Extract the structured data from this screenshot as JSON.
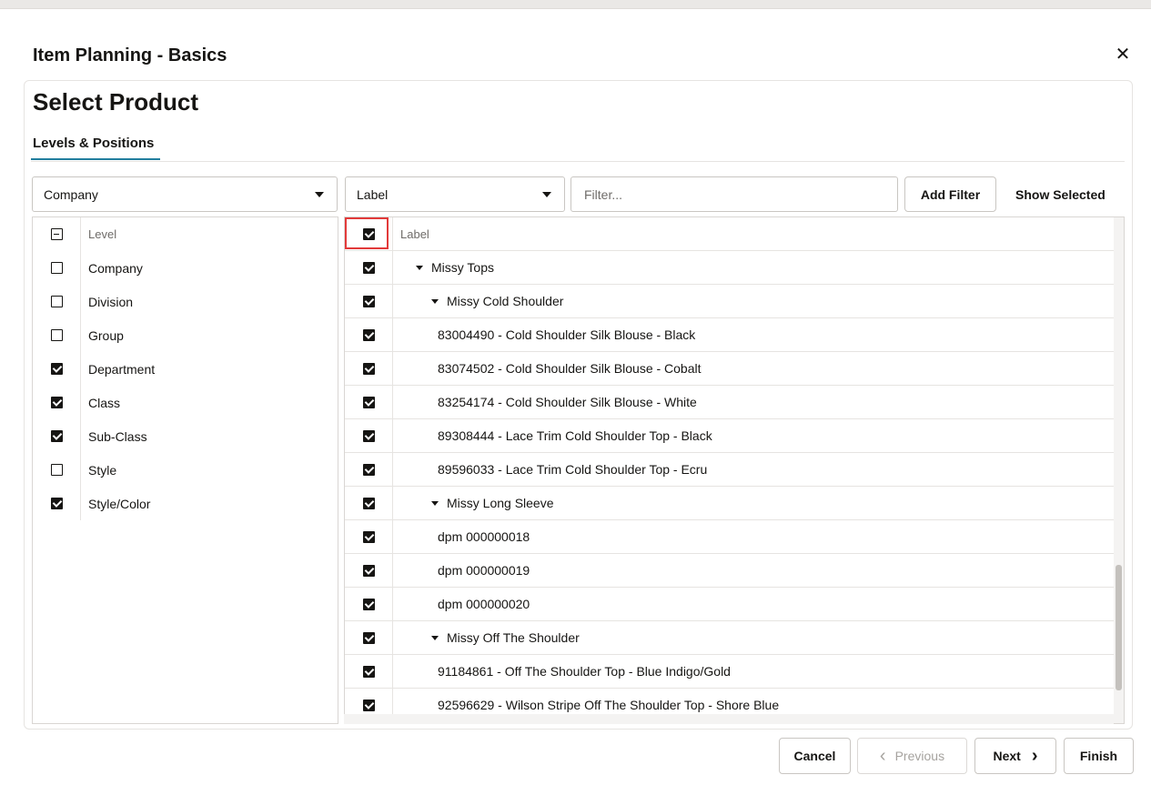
{
  "dialog": {
    "title": "Item Planning - Basics",
    "close_icon": "close-icon",
    "close_glyph": "✕"
  },
  "section": {
    "title": "Select Product",
    "tab_label": "Levels & Positions"
  },
  "toolbar": {
    "level_select_value": "Company",
    "label_select_value": "Label",
    "filter_placeholder": "Filter...",
    "add_filter_label": "Add Filter",
    "show_selected_label": "Show Selected"
  },
  "levels": {
    "header": "Level",
    "header_state": "partial",
    "items": [
      {
        "label": "Company",
        "checked": false
      },
      {
        "label": "Division",
        "checked": false
      },
      {
        "label": "Group",
        "checked": false
      },
      {
        "label": "Department",
        "checked": true
      },
      {
        "label": "Class",
        "checked": true
      },
      {
        "label": "Sub-Class",
        "checked": true
      },
      {
        "label": "Style",
        "checked": false
      },
      {
        "label": "Style/Color",
        "checked": true
      }
    ]
  },
  "labels": {
    "header": "Label",
    "header_checked": true,
    "items": [
      {
        "label": "Missy Tops",
        "depth": 1,
        "expanded": true,
        "checked": true
      },
      {
        "label": "Missy Cold Shoulder",
        "depth": 2,
        "expanded": true,
        "checked": true
      },
      {
        "label": "83004490 - Cold Shoulder Silk Blouse - Black",
        "depth": 3,
        "checked": true
      },
      {
        "label": "83074502 - Cold Shoulder Silk Blouse - Cobalt",
        "depth": 3,
        "checked": true
      },
      {
        "label": "83254174 - Cold Shoulder Silk Blouse - White",
        "depth": 3,
        "checked": true
      },
      {
        "label": "89308444 - Lace Trim Cold Shoulder Top - Black",
        "depth": 3,
        "checked": true
      },
      {
        "label": "89596033 - Lace Trim Cold Shoulder Top - Ecru",
        "depth": 3,
        "checked": true
      },
      {
        "label": "Missy Long Sleeve",
        "depth": 2,
        "expanded": true,
        "checked": true
      },
      {
        "label": "dpm 000000018",
        "depth": 3,
        "checked": true
      },
      {
        "label": "dpm 000000019",
        "depth": 3,
        "checked": true
      },
      {
        "label": "dpm 000000020",
        "depth": 3,
        "checked": true
      },
      {
        "label": "Missy Off The Shoulder",
        "depth": 2,
        "expanded": true,
        "checked": true
      },
      {
        "label": "91184861 - Off The Shoulder Top - Blue Indigo/Gold",
        "depth": 3,
        "checked": true
      },
      {
        "label": "92596629 - Wilson Stripe Off The Shoulder Top - Shore Blue",
        "depth": 3,
        "checked": true
      }
    ]
  },
  "footer": {
    "cancel_label": "Cancel",
    "previous_label": "Previous",
    "previous_glyph": "‹",
    "next_label": "Next",
    "next_glyph": "›",
    "finish_label": "Finish"
  },
  "colors": {
    "tab_accent": "#227e9e",
    "highlight": "#e23a3a"
  }
}
